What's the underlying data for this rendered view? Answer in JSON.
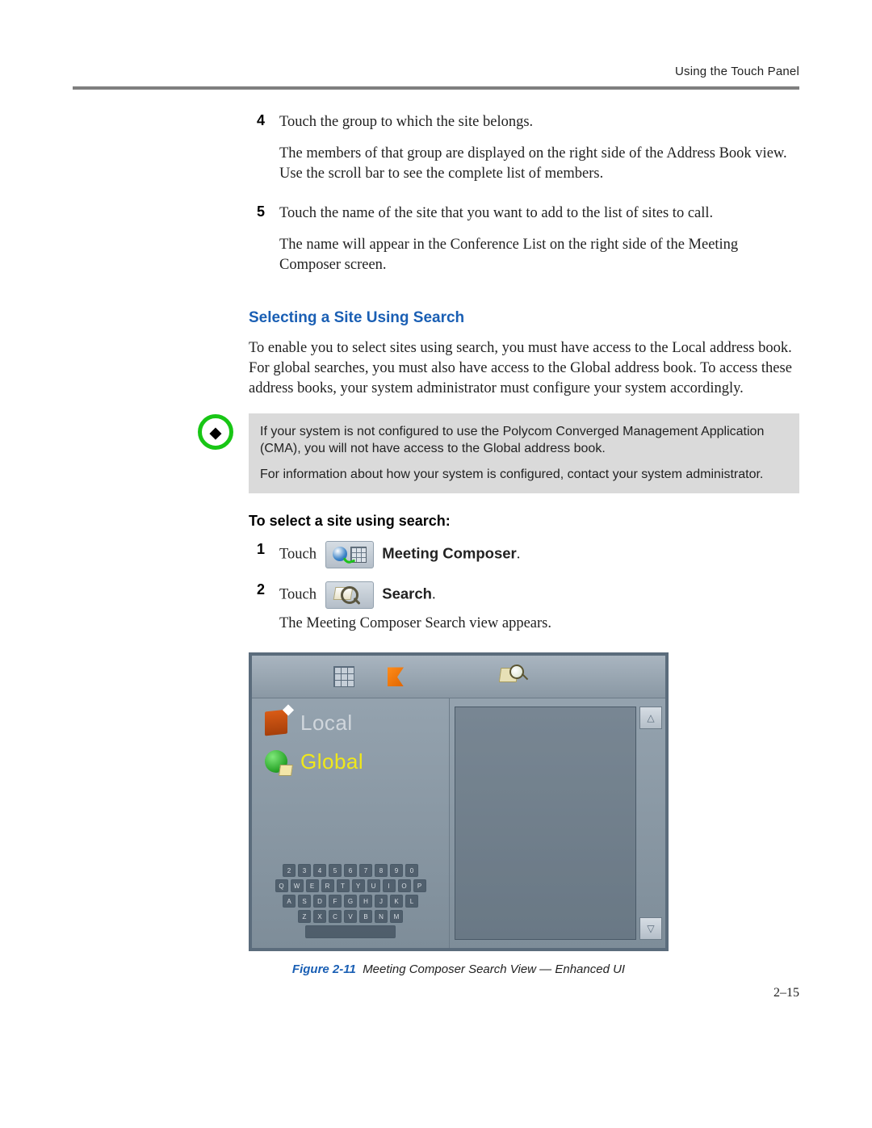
{
  "header": {
    "chapter": "Using the Touch Panel"
  },
  "steps_a": [
    {
      "num": "4",
      "lines": [
        "Touch the group to which the site belongs.",
        "The members of that group are displayed on the right side of the Address Book view. Use the scroll bar to see the complete list of members."
      ]
    },
    {
      "num": "5",
      "lines": [
        "Touch the name of the site that you want to add to the list of sites to call.",
        "The name will appear in the Conference List on the right side of the Meeting Composer screen."
      ]
    }
  ],
  "section_heading": "Selecting a Site Using Search",
  "section_body": "To enable you to select sites using search, you must have access to the Local address book. For global searches, you must also have access to the Global address book. To access these address books, your system administrator must configure your system accordingly.",
  "note": {
    "p1": "If your system is not configured to use the Polycom Converged Management Application (CMA), you will not have access to the Global address book.",
    "p2": "For information about how your system is configured, contact your system administrator."
  },
  "procedure_heading": "To select a site using search:",
  "steps_b": [
    {
      "num": "1",
      "pre": "Touch ",
      "icon": "mc",
      "post_bold": "Meeting Composer",
      "post_end": "."
    },
    {
      "num": "2",
      "pre": "Touch ",
      "icon": "search",
      "post_bold": "Search",
      "post_end": "."
    }
  ],
  "steps_b_tail": "The Meeting Composer Search view appears.",
  "figure": {
    "list": {
      "local": "Local",
      "global": "Global"
    },
    "keyboard_rows": [
      [
        "2",
        "3",
        "4",
        "5",
        "6",
        "7",
        "8",
        "9",
        "0"
      ],
      [
        "Q",
        "W",
        "E",
        "R",
        "T",
        "Y",
        "U",
        "I",
        "O",
        "P"
      ],
      [
        "A",
        "S",
        "D",
        "F",
        "G",
        "H",
        "J",
        "K",
        "L"
      ],
      [
        "Z",
        "X",
        "C",
        "V",
        "B",
        "N",
        "M"
      ]
    ],
    "ref": "Figure 2-11",
    "caption": "Meeting Composer Search View — Enhanced UI"
  },
  "page_number": "2–15"
}
